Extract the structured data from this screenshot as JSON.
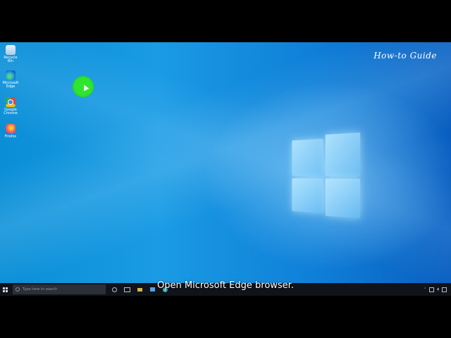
{
  "watermark": "How-to Guide",
  "desktop": {
    "icons": [
      {
        "label": "Recycle Bin",
        "icon": "recycle-bin-icon"
      },
      {
        "label": "Microsoft Edge",
        "icon": "edge-icon"
      },
      {
        "label": "Google Chrome",
        "icon": "chrome-icon"
      },
      {
        "label": "Firefox",
        "icon": "firefox-icon"
      }
    ]
  },
  "taskbar": {
    "search_placeholder": "Type here to search"
  },
  "caption": "Open Microsoft Edge browser.",
  "colors": {
    "desktop_blue": "#0a8ed6",
    "taskbar": "#10131a",
    "cursor_highlight": "#2ee62e"
  }
}
